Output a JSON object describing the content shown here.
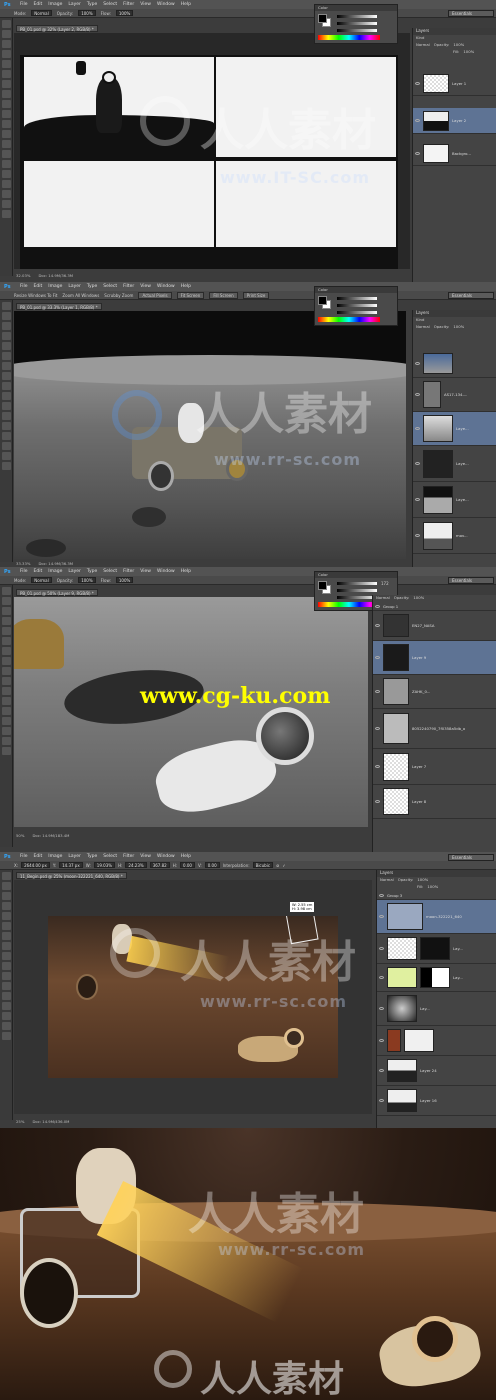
{
  "menu": {
    "app_icon": "Ps",
    "items": [
      "File",
      "Edit",
      "Image",
      "Layer",
      "Type",
      "Select",
      "Filter",
      "View",
      "Window",
      "Help"
    ]
  },
  "workspace": "Essentials",
  "color_tab": "Color",
  "layers_tab": "Layers",
  "layers_filter": "Kind",
  "blend_mode": "Normal",
  "opacity_label": "Opacity:",
  "opacity_value": "100%",
  "fill_label": "Fill:",
  "fill_value": "100%",
  "panels": [
    {
      "options": [
        "Mode:",
        "Normal",
        "Opacity:",
        "100%",
        "Flow:",
        "100%"
      ],
      "doc_tab": "PB_01.psd @ 32% (Layer 2, RGB/8) *",
      "status_zoom": "32.03%",
      "status_doc": "Doc: 14.9M/36.3M",
      "layers": [
        {
          "name": "Layer 1",
          "selected": false
        },
        {
          "name": "Layer 2",
          "selected": true
        },
        {
          "name": "Backgro...",
          "selected": false
        }
      ]
    },
    {
      "options": [
        "Resize Windows To Fit",
        "Zoom All Windows",
        "Scrubby Zoom",
        "Actual Pixels",
        "Fit Screen",
        "Fill Screen",
        "Print Size"
      ],
      "doc_tab": "PB_01.psd @ 33.3% (Layer 1, RGB/8) *",
      "status_zoom": "33.33%",
      "status_doc": "Doc: 14.9M/36.3M",
      "layers": [
        {
          "name": "",
          "selected": false
        },
        {
          "name": "AS17-134-...",
          "selected": false
        },
        {
          "name": "Laye...",
          "selected": true
        },
        {
          "name": "Laye...",
          "selected": false
        },
        {
          "name": "Laye...",
          "selected": false
        },
        {
          "name": "mov...",
          "selected": false
        }
      ]
    },
    {
      "options": [
        "Mode:",
        "Normal",
        "Opacity:",
        "100%",
        "Flow:",
        "100%"
      ],
      "doc_tab": "PB_01.psd @ 50% (Layer 9, RGB/8) *",
      "status_zoom": "50%",
      "status_doc": "Doc: 14.9M/183.4M",
      "color_value": "172",
      "layers": [
        {
          "name": "Group 1",
          "selected": false
        },
        {
          "name": "EN27_NASA",
          "selected": false
        },
        {
          "name": "Layer 9",
          "selected": true
        },
        {
          "name": "ZAHK_0...",
          "selected": false
        },
        {
          "name": "8052240790_7f0358a5db_o",
          "selected": false
        },
        {
          "name": "Layer 7",
          "selected": false
        },
        {
          "name": "Layer 8",
          "selected": false
        }
      ],
      "overlay_text": "www.cg-ku.com"
    },
    {
      "options": [
        "X:",
        "2644.00 px",
        "Y:",
        "14.37 px",
        "W:",
        "19.03%",
        "H:",
        "24.23%",
        "367.82",
        "H:",
        "0.00",
        "V:",
        "0.00",
        "Interpolation:",
        "Bicubic"
      ],
      "doc_tab": "11_Begin.psd @ 25% (moon-322221_640, RGB/8) *",
      "status_zoom": "25%",
      "status_doc": "Doc: 14.9M/436.0M",
      "transform_readout": [
        "W: 2.55 cm",
        "H: 3.98 cm"
      ],
      "layers": [
        {
          "name": "Group 3",
          "selected": false
        },
        {
          "name": "moon-322221_640",
          "selected": true
        },
        {
          "name": "Lay...",
          "selected": false
        },
        {
          "name": "Lay...",
          "selected": false
        },
        {
          "name": "Lay...",
          "selected": false
        },
        {
          "name": "",
          "selected": false
        },
        {
          "name": "Layer 24",
          "selected": false
        },
        {
          "name": "Layer 16",
          "selected": false
        }
      ]
    }
  ],
  "watermark": {
    "chinese": "人人素材",
    "url": "www.rr-sc.com",
    "url_variant": "www.IT-SC.com"
  },
  "colors": {
    "selected_layer": "#5e7394",
    "ps_blue": "#31a8ff"
  }
}
